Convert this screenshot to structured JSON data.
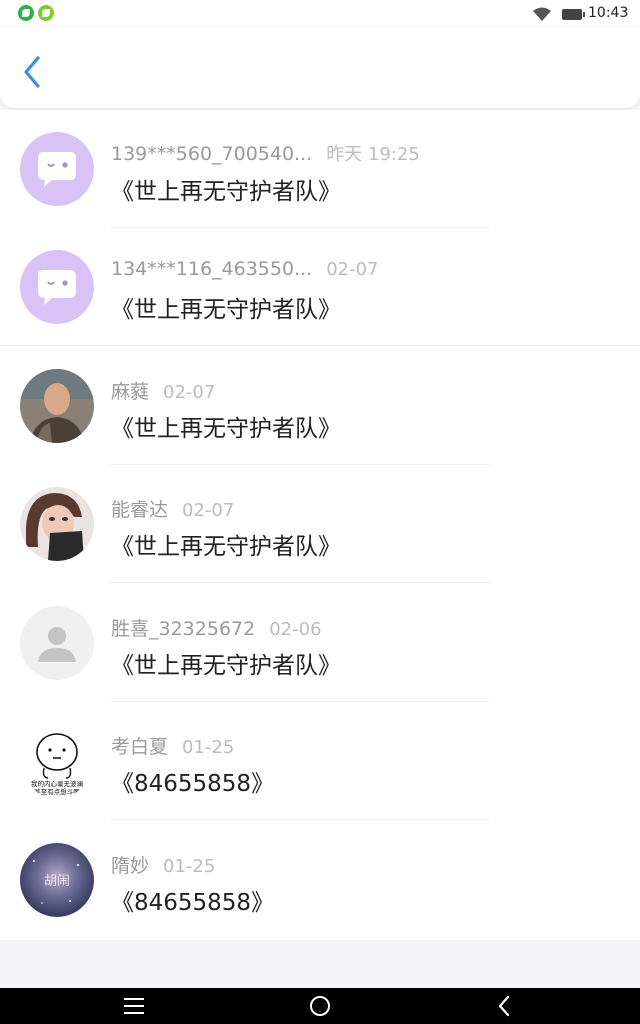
{
  "status_bar": {
    "time": "10:43",
    "icons": [
      "wechat-notification-icon",
      "leaf-notification-icon",
      "wifi-icon",
      "battery-icon"
    ]
  },
  "header": {
    "back_icon": "chevron-left-icon",
    "accent": "#3a8ee6"
  },
  "messages": [
    {
      "name": "139***560_700540...",
      "date": "昨天 19:25",
      "text": "《世上再无守护者队》",
      "avatar": "chat-bubble-avatar"
    },
    {
      "name": "134***116_463550...",
      "date": "02-07",
      "text": "《世上再无守护者队》",
      "avatar": "chat-bubble-avatar"
    },
    {
      "name": "麻蕤",
      "date": "02-07",
      "text": "《世上再无守护者队》",
      "avatar": "photo-avatar"
    },
    {
      "name": "能睿达",
      "date": "02-07",
      "text": "《世上再无守护者队》",
      "avatar": "photo-avatar"
    },
    {
      "name": "胜喜_32325672",
      "date": "02-06",
      "text": "《世上再无守护者队》",
      "avatar": "default-person-avatar"
    },
    {
      "name": "考白夏",
      "date": "01-25",
      "text": "《84655858》",
      "avatar": "meme-avatar",
      "avatar_text": [
        "我的内心毫无波澜",
        "甚至有点想斗图"
      ]
    },
    {
      "name": "隋妙",
      "date": "01-25",
      "text": "《84655858》",
      "avatar": "galaxy-avatar",
      "avatar_text": "胡闹"
    }
  ],
  "nav_bar": {
    "icons": [
      "menu-icon",
      "home-icon",
      "back-icon"
    ]
  }
}
